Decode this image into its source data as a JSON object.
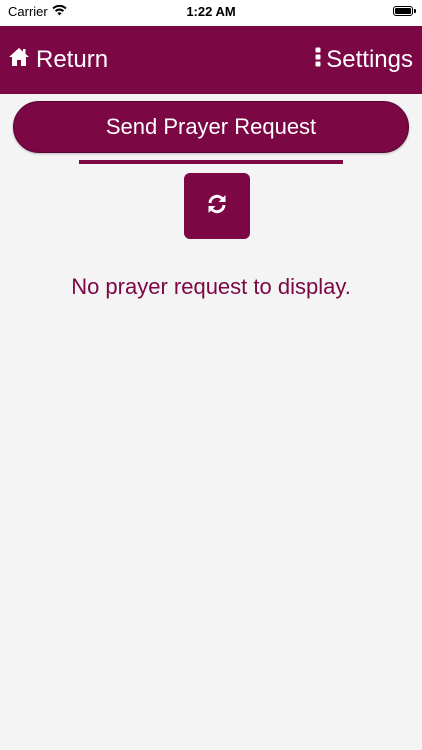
{
  "status_bar": {
    "carrier": "Carrier",
    "time": "1:22 AM",
    "icons": [
      "wifi-icon",
      "battery-icon"
    ]
  },
  "nav": {
    "return_label": "Return",
    "return_icon": "home-icon",
    "settings_label": "Settings",
    "settings_icon": "vertical-ellipsis-icon"
  },
  "main": {
    "send_button_label": "Send Prayer Request",
    "refresh_icon": "refresh-icon",
    "empty_message": "No prayer request to display."
  },
  "colors": {
    "brand": "#7b0745",
    "background": "#f4f4f4",
    "text_on_brand": "#ffffff"
  }
}
